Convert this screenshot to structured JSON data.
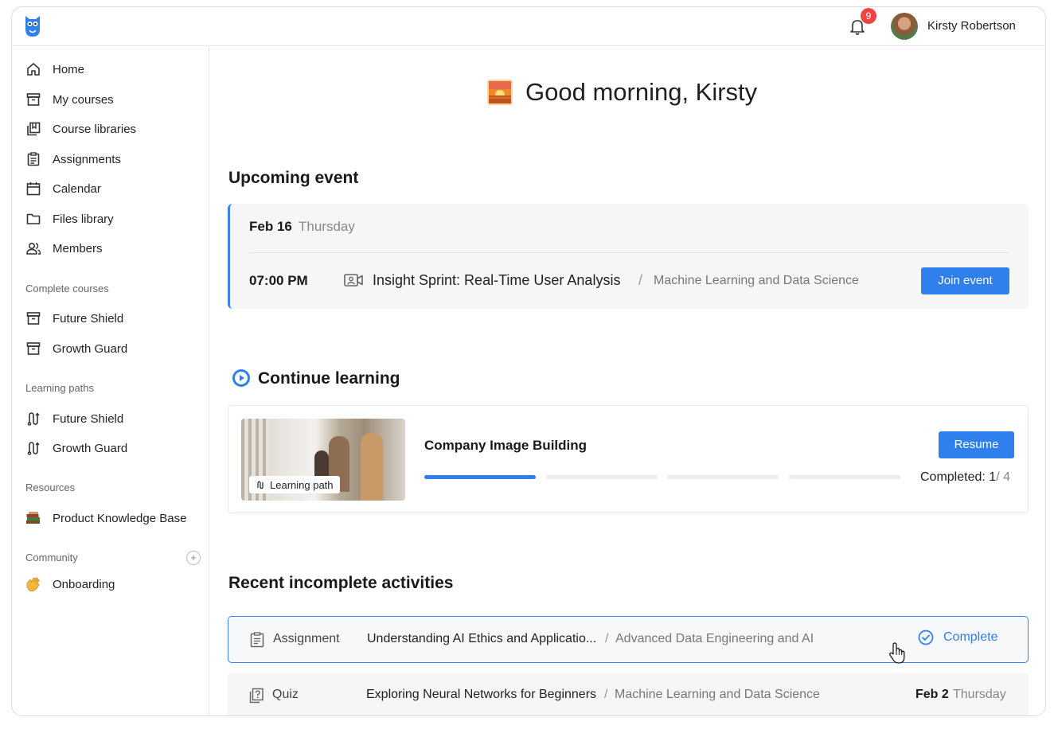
{
  "header": {
    "notification_count": "9",
    "user_name": "Kirsty Robertson"
  },
  "sidebar": {
    "main_items": [
      {
        "label": "Home",
        "icon": "home-icon"
      },
      {
        "label": "My courses",
        "icon": "archive-icon"
      },
      {
        "label": "Course libraries",
        "icon": "library-icon"
      },
      {
        "label": "Assignments",
        "icon": "clipboard-icon"
      },
      {
        "label": "Calendar",
        "icon": "calendar-icon"
      },
      {
        "label": "Files library",
        "icon": "folder-icon"
      },
      {
        "label": "Members",
        "icon": "users-icon"
      }
    ],
    "complete_courses": {
      "label": "Complete courses",
      "items": [
        {
          "label": "Future Shield",
          "icon": "archive-icon"
        },
        {
          "label": "Growth Guard",
          "icon": "archive-icon"
        }
      ]
    },
    "learning_paths": {
      "label": "Learning paths",
      "items": [
        {
          "label": "Future Shield",
          "icon": "path-icon"
        },
        {
          "label": "Growth Guard",
          "icon": "path-icon"
        }
      ]
    },
    "resources": {
      "label": "Resources",
      "items": [
        {
          "label": "Product Knowledge Base",
          "icon": "books-icon"
        }
      ]
    },
    "community": {
      "label": "Community",
      "add_label": "+",
      "items": [
        {
          "label": "Onboarding",
          "icon": "waving-hand-icon"
        }
      ]
    }
  },
  "greeting": {
    "text": "Good morning, Kirsty",
    "icon": "sunrise-icon"
  },
  "upcoming_event": {
    "heading": "Upcoming event",
    "date": "Feb 16",
    "day": "Thursday",
    "time": "07:00 PM",
    "title": "Insight Sprint: Real-Time User Analysis",
    "separator": "/",
    "course": "Machine Learning and Data Science",
    "join_label": "Join event"
  },
  "continue_learning": {
    "heading": "Continue learning",
    "tag": "Learning path",
    "course_title": "Company Image Building",
    "resume_label": "Resume",
    "completed_label": "Completed:",
    "completed_done": "1",
    "completed_total": "/ 4",
    "progress_segments": [
      true,
      false,
      false,
      false
    ]
  },
  "recent_activities": {
    "heading": "Recent incomplete activities",
    "items": [
      {
        "type": "Assignment",
        "title": "Understanding AI Ethics and Applicatio...",
        "separator": "/",
        "course": "Advanced Data Engineering and AI",
        "action_label": "Complete"
      },
      {
        "type": "Quiz",
        "title": "Exploring Neural Networks for Beginners",
        "separator": "/",
        "course": "Machine Learning and Data Science",
        "date": "Feb 2",
        "day": "Thursday"
      }
    ]
  },
  "colors": {
    "accent": "#2f80ed",
    "badge": "#ef4444",
    "card_bg": "#f6f6f6"
  }
}
